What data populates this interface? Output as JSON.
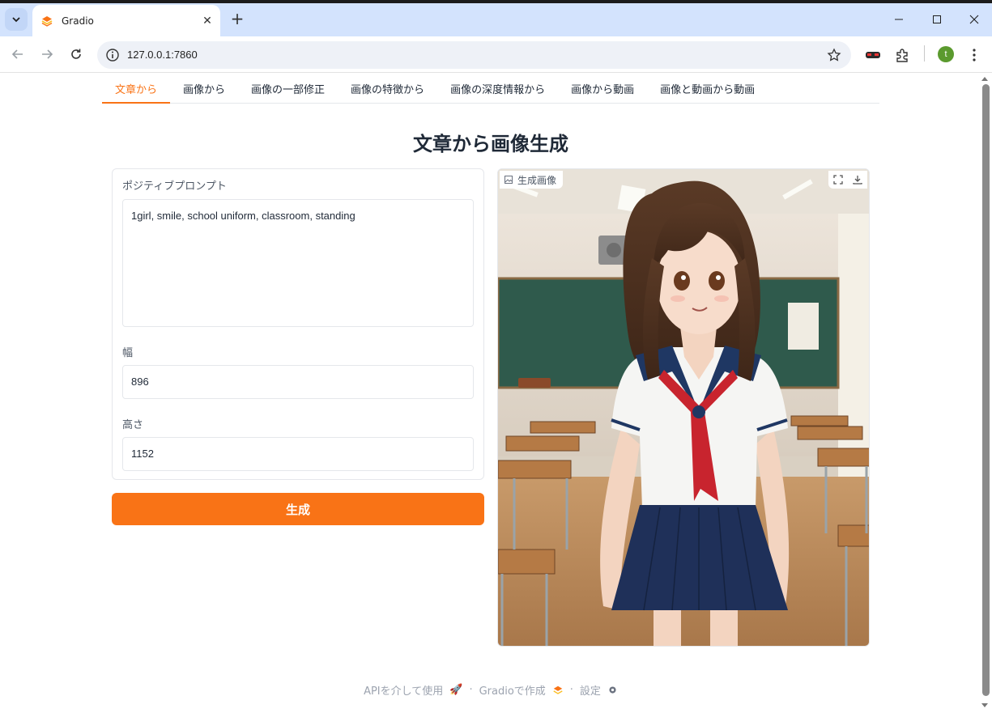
{
  "browser": {
    "tab_title": "Gradio",
    "url": "127.0.0.1:7860",
    "profile_initial": "t"
  },
  "nav_tabs": [
    {
      "label": "文章から",
      "active": true
    },
    {
      "label": "画像から",
      "active": false
    },
    {
      "label": "画像の一部修正",
      "active": false
    },
    {
      "label": "画像の特徴から",
      "active": false
    },
    {
      "label": "画像の深度情報から",
      "active": false
    },
    {
      "label": "画像から動画",
      "active": false
    },
    {
      "label": "画像と動画から動画",
      "active": false
    }
  ],
  "page_title": "文章から画像生成",
  "form": {
    "prompt_label": "ポジティブプロンプト",
    "prompt_value": "1girl, smile, school uniform, classroom, standing",
    "width_label": "幅",
    "width_value": "896",
    "height_label": "高さ",
    "height_value": "1152",
    "generate_label": "生成"
  },
  "output": {
    "label": "生成画像"
  },
  "footer": {
    "api": "APIを介して使用",
    "built_with": "Gradioで作成",
    "settings": "設定"
  },
  "colors": {
    "accent": "#f97316",
    "tabstrip": "#d3e3fd"
  }
}
